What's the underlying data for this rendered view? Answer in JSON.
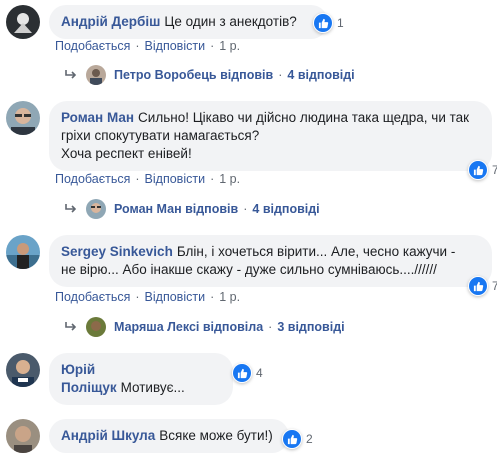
{
  "comments": [
    {
      "author": "Андрій Дербіш",
      "lines": [
        "Це один з анекдотів?"
      ],
      "reactions": "1",
      "actions": {
        "like": "Подобається",
        "reply": "Відповісти",
        "time": "1 р."
      },
      "replies": {
        "name": "Петро Воробець відповів",
        "count": "4 відповіді"
      }
    },
    {
      "author": "Роман Ман",
      "lines": [
        "Сильно! Цікаво чи дійсно людина така щедра, чи так",
        "гріхи спокутувати намагається?",
        "Хоча респект енівей!"
      ],
      "reactions": "7",
      "actions": {
        "like": "Подобається",
        "reply": "Відповісти",
        "time": "1 р."
      },
      "replies": {
        "name": "Роман Ман відповів",
        "count": "4 відповіді"
      }
    },
    {
      "author": "Sergey Sinkevich",
      "lines": [
        "Блін, і хочеться вірити... Але, чесно кажучи -",
        "не вірю... Або інакше скажу - дуже сильно сумніваюсь....//////"
      ],
      "reactions": "7",
      "actions": {
        "like": "Подобається",
        "reply": "Відповісти",
        "time": "1 р."
      },
      "replies": {
        "name": "Маряша Лексі відповіла",
        "count": "3 відповіді"
      }
    },
    {
      "author": "Юрій Поліщук",
      "lines": [
        "Мотивує..."
      ],
      "reactions": "4"
    },
    {
      "author": "Андрій Шкула",
      "lines": [
        "Всяке може бути!)"
      ],
      "reactions": "2"
    }
  ],
  "icons": {
    "like": "like-thumb-icon",
    "reply": "reply-arrow-icon"
  },
  "colors": {
    "link": "#385898",
    "bubble": "#f2f3f5",
    "like": "#1877f2",
    "meta": "#606770"
  }
}
